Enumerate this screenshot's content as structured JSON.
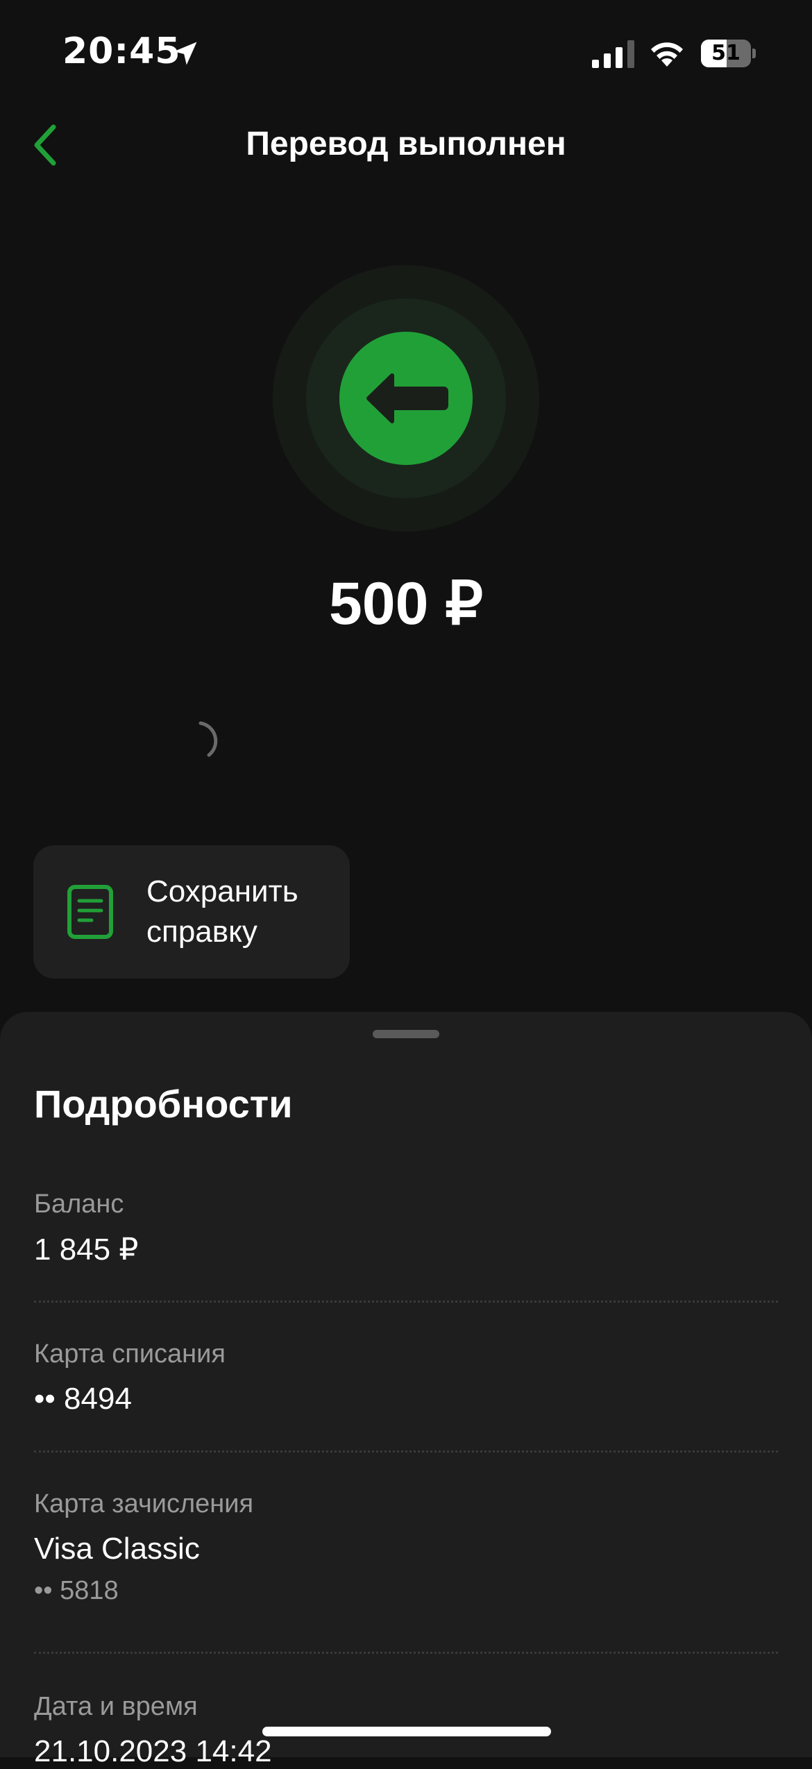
{
  "status_bar": {
    "time": "20:45",
    "battery_level": "51",
    "battery_fraction": 0.51
  },
  "header": {
    "title": "Перевод выполнен"
  },
  "transfer": {
    "amount": "500 ₽",
    "icon": "arrow-left-icon",
    "accent_color": "#21A038"
  },
  "actions": {
    "save_receipt_label": "Сохранить справку"
  },
  "details": {
    "title": "Подробности",
    "rows": [
      {
        "label": "Баланс",
        "value": "1 845 ₽"
      },
      {
        "label": "Карта списания",
        "value": "•• 8494"
      },
      {
        "label": "Карта зачисления",
        "value": "Visa Classic",
        "sub": "•• 5818"
      },
      {
        "label": "Дата и время",
        "value": "21.10.2023 14:42"
      }
    ]
  }
}
